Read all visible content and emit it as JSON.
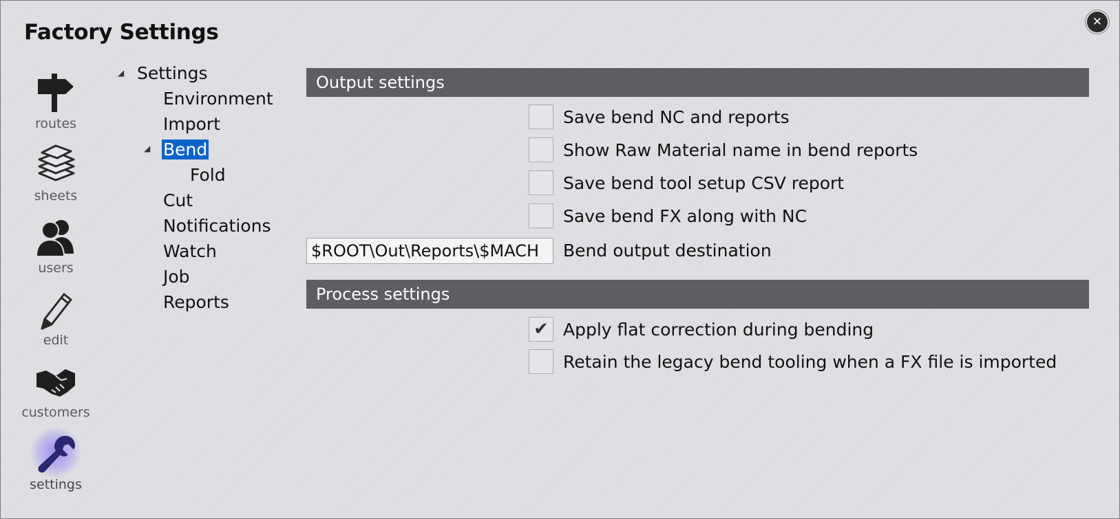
{
  "window": {
    "title": "Factory Settings",
    "close_symbol": "✕"
  },
  "nav": {
    "items": [
      {
        "label": "routes",
        "icon": "signpost-icon"
      },
      {
        "label": "sheets",
        "icon": "sheets-stack-icon"
      },
      {
        "label": "users",
        "icon": "users-icon"
      },
      {
        "label": "edit",
        "icon": "pencil-icon"
      },
      {
        "label": "customers",
        "icon": "handshake-icon"
      },
      {
        "label": "settings",
        "icon": "wrench-icon",
        "active": true
      }
    ]
  },
  "tree": {
    "root": "Settings",
    "items": [
      "Environment",
      "Import",
      "Bend",
      "Fold",
      "Cut",
      "Notifications",
      "Watch",
      "Job",
      "Reports"
    ],
    "selected": "Bend"
  },
  "output_section": {
    "header": "Output settings",
    "options": [
      {
        "label": "Save bend NC and reports",
        "checked": false
      },
      {
        "label": "Show Raw Material name in bend reports",
        "checked": false
      },
      {
        "label": "Save bend tool setup CSV report",
        "checked": false
      },
      {
        "label": "Save bend FX along with NC",
        "checked": false
      }
    ],
    "destination_value": "$ROOT\\Out\\Reports\\$MACH",
    "destination_label": "Bend output destination"
  },
  "process_section": {
    "header": "Process settings",
    "options": [
      {
        "label": "Apply flat correction during bending",
        "checked": true
      },
      {
        "label": "Retain the legacy bend tooling when a FX file is imported",
        "checked": false
      }
    ]
  },
  "colors": {
    "header_bg": "#5d5d63",
    "selection": "#0a64c8",
    "settings_glow": "#6e50ff"
  }
}
